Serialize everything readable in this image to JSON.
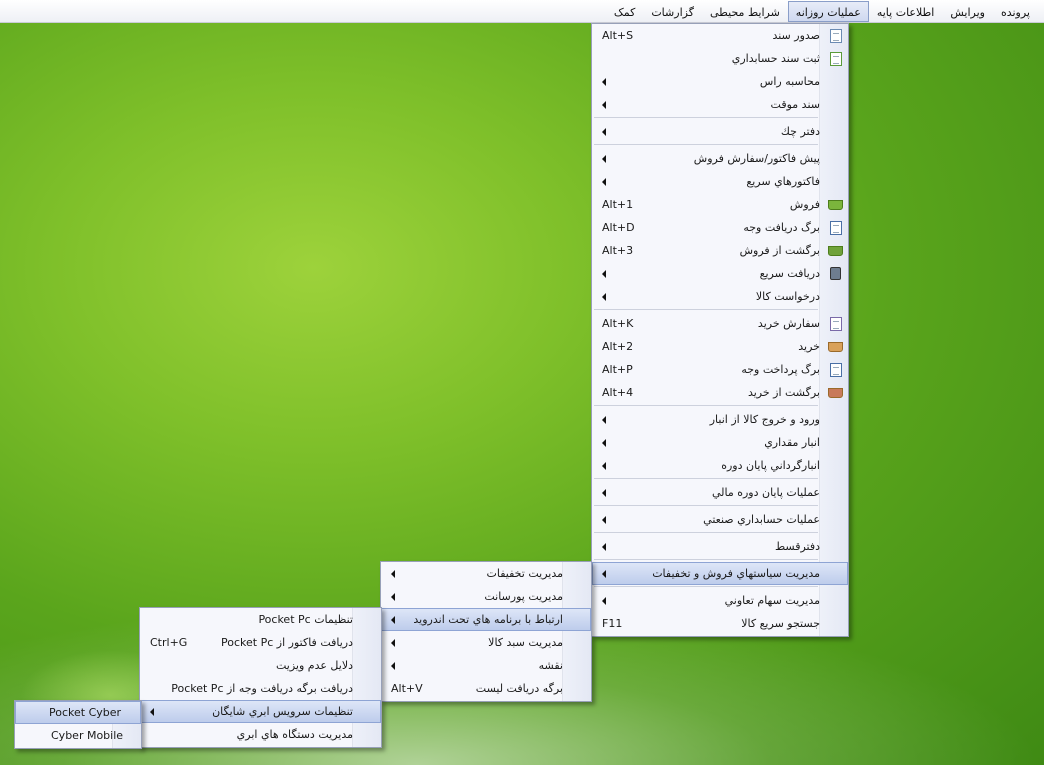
{
  "menubar": [
    {
      "label": "پرونده",
      "active": false
    },
    {
      "label": "ویرایش",
      "active": false
    },
    {
      "label": "اطلاعات پایه",
      "active": false
    },
    {
      "label": "عملیات روزانه",
      "active": true
    },
    {
      "label": "شرایط محیطی",
      "active": false
    },
    {
      "label": "گزارشات",
      "active": false
    },
    {
      "label": "کمک",
      "active": false
    }
  ],
  "main_menu": {
    "items": [
      {
        "label": "صدور سند",
        "shortcut": "Alt+S",
        "icon": "document-icon"
      },
      {
        "label": "ثبت سند حسابداري",
        "icon": "document-edit-icon"
      },
      {
        "label": "محاسبه راس",
        "submenu": true
      },
      {
        "label": "سند موقت",
        "submenu": true
      },
      {
        "label": "دفتر چك",
        "submenu": true
      },
      {
        "label": "پيش فاكتور/سفارش فروش",
        "submenu": true
      },
      {
        "label": "فاكتورهاي سريع",
        "submenu": true
      },
      {
        "label": "فروش",
        "shortcut": "Alt+1",
        "icon": "basket-icon"
      },
      {
        "label": "برگ دريافت وجه",
        "shortcut": "Alt+D",
        "icon": "receipt-icon"
      },
      {
        "label": "برگشت از فروش",
        "shortcut": "Alt+3",
        "icon": "basket-return-icon"
      },
      {
        "label": "دريافت سريع",
        "submenu": true,
        "icon": "calculator-icon"
      },
      {
        "label": "درخواست كالا",
        "submenu": true
      },
      {
        "label": "سفارش خريد",
        "shortcut": "Alt+K",
        "icon": "checklist-icon"
      },
      {
        "label": "خريد",
        "shortcut": "Alt+2",
        "icon": "basket-buy-icon"
      },
      {
        "label": "برگ پرداخت وجه",
        "shortcut": "Alt+P",
        "icon": "payment-icon"
      },
      {
        "label": "برگشت از خريد",
        "shortcut": "Alt+4",
        "icon": "basket-return-buy-icon"
      },
      {
        "label": "ورود و خروج كالا از انبار",
        "submenu": true
      },
      {
        "label": "انبار مقداري",
        "submenu": true
      },
      {
        "label": "انبارگرداني پايان دوره",
        "submenu": true
      },
      {
        "label": "عمليات پايان دوره مالي",
        "submenu": true
      },
      {
        "label": "عمليات حسابداري صنعتي",
        "submenu": true
      },
      {
        "label": "دفترقسط",
        "submenu": true
      },
      {
        "label": "مديريت سياستهاي فروش و تخفيفات",
        "submenu": true
      },
      {
        "label": "مديريت سهام تعاوني",
        "submenu": true
      },
      {
        "label": "جستجو سريع كالا",
        "shortcut": "F11"
      }
    ]
  },
  "sub1": {
    "items": [
      {
        "label": "مديريت تخفيفات",
        "submenu": true
      },
      {
        "label": "مديريت پورسانت",
        "submenu": true
      },
      {
        "label": "ارتباط با برنامه هاي تحت اندرويد",
        "submenu": true
      },
      {
        "label": "مديريت سبد كالا",
        "submenu": true
      },
      {
        "label": "نقشه",
        "submenu": true
      },
      {
        "label": "برگه دريافت ليست",
        "shortcut": "Alt+V"
      }
    ]
  },
  "sub2": {
    "items": [
      {
        "label": "تنظيمات Pocket Pc"
      },
      {
        "label": "دريافت فاكتور از Pocket Pc",
        "shortcut": "Ctrl+G"
      },
      {
        "label": "دلايل عدم ويزيت"
      },
      {
        "label": "دريافت برگه دريافت وجه از Pocket Pc"
      },
      {
        "label": "تنظيمات سرويس ابري شايگان",
        "submenu": true
      },
      {
        "label": "مديريت دستگاه هاي ابري"
      }
    ]
  },
  "sub3": {
    "items": [
      {
        "label": "Pocket Cyber"
      },
      {
        "label": "Cyber Mobile"
      }
    ]
  }
}
